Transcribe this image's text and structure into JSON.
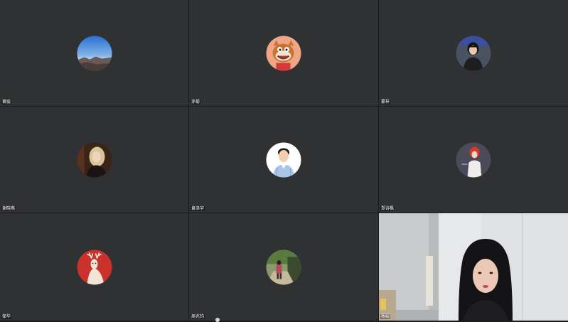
{
  "participants": [
    {
      "name": "黄骏",
      "avatar": "mountain-sky-avatar",
      "active": false
    },
    {
      "name": "涂菊",
      "avatar": "cartoon-cat-avatar",
      "active": false
    },
    {
      "name": "蒙梓",
      "avatar": "girl-portrait-avatar",
      "active": false
    },
    {
      "name": "谢晓燕",
      "avatar": "blonde-woman-avatar",
      "active": false
    },
    {
      "name": "袁泽宇",
      "avatar": "man-shirt-avatar",
      "active": false
    },
    {
      "name": "郑诗枫",
      "avatar": "red-hair-girl-avatar",
      "active": false
    },
    {
      "name": "邹华",
      "avatar": "deer-avatar",
      "active": false
    },
    {
      "name": "周兆钧",
      "avatar": "street-photo-avatar",
      "active": false
    },
    {
      "name": "杨娟",
      "avatar": "live-video",
      "active": true
    }
  ],
  "colors": {
    "tile_bg": "#2f3133",
    "active_border": "#4fc16a",
    "grid_gap": "#1a1c1e"
  }
}
